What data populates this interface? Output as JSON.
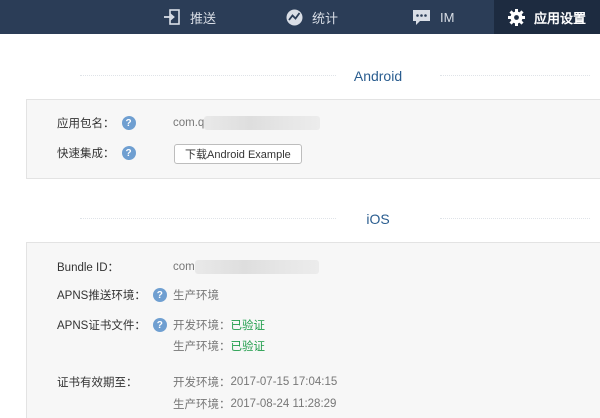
{
  "nav": {
    "push": "推送",
    "stats": "统计",
    "im": "IM",
    "settings": "应用设置"
  },
  "android": {
    "title": "Android",
    "package_label": "应用包名：",
    "package_value": "com.q",
    "quick_label": "快速集成：",
    "download_button": "下载Android Example"
  },
  "ios": {
    "title": "iOS",
    "bundle_label": "Bundle ID：",
    "bundle_value": "com",
    "apns_env_label": "APNS推送环境：",
    "apns_env_value": "生产环境",
    "apns_cert_label": "APNS证书文件：",
    "dev_env_label": "开发环境：",
    "dev_status": "已验证",
    "prod_env_label": "生产环境：",
    "prod_status": "已验证",
    "expiry_label": "证书有效期至：",
    "expiry_dev_label": "开发环境：",
    "expiry_dev_value": "2017-07-15 17:04:15",
    "expiry_prod_label": "生产环境：",
    "expiry_prod_value": "2017-08-24 11:28:29"
  },
  "help_glyph": "?",
  "colors": {
    "nav_bg": "#2b3d57",
    "nav_active_bg": "#1d2b40",
    "section_title": "#2a5d8f",
    "verified": "#1f9d4a",
    "help_icon": "#6f9fd1"
  }
}
